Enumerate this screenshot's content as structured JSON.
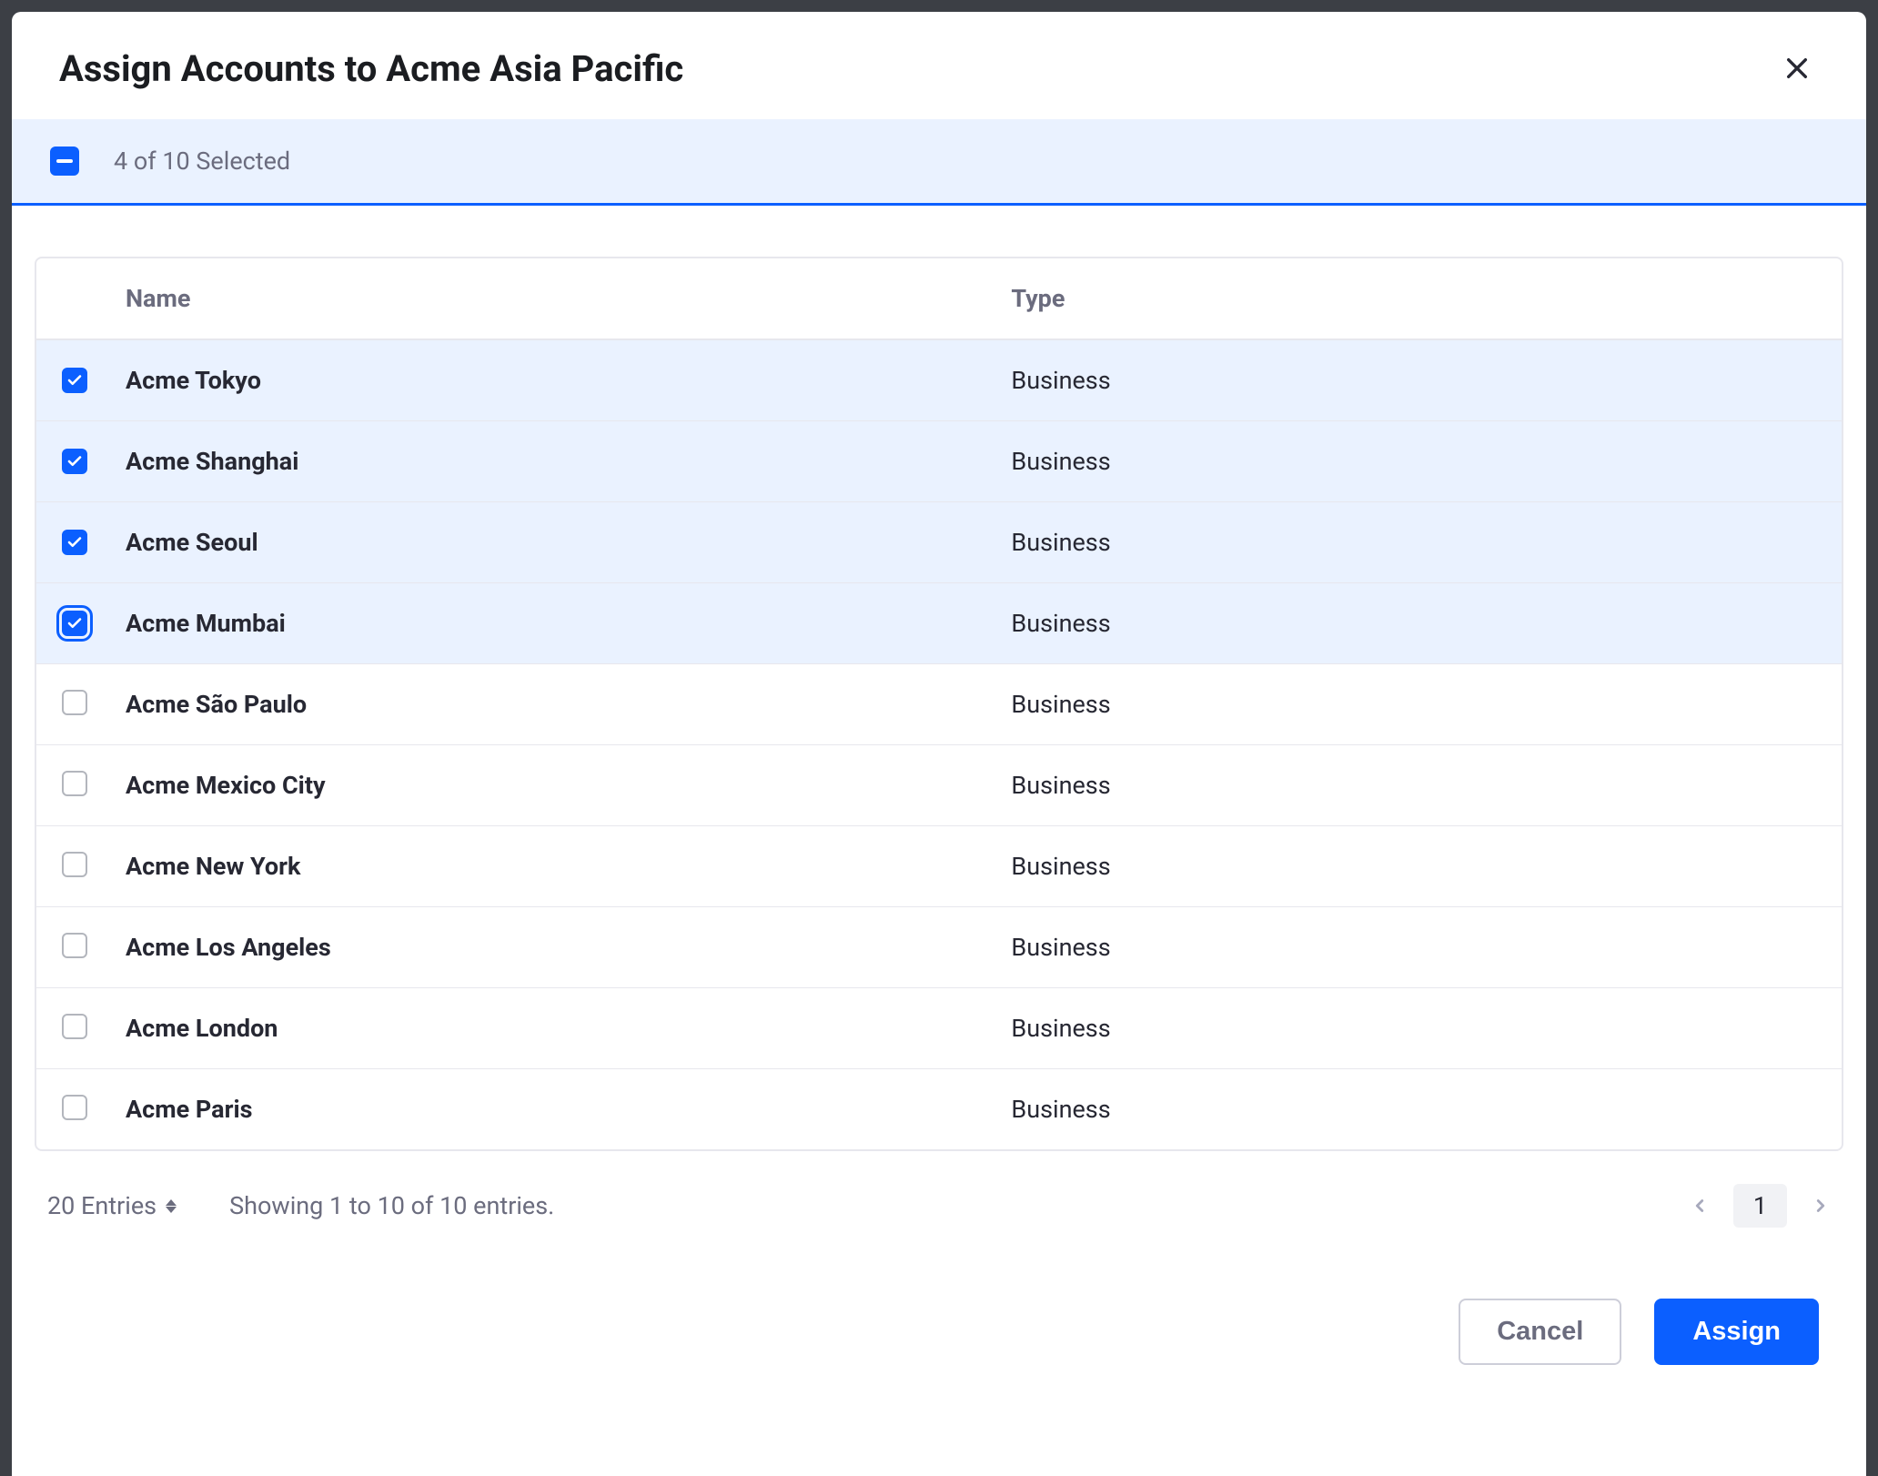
{
  "modal": {
    "title": "Assign Accounts to Acme Asia Pacific",
    "selection_text": "4 of 10 Selected"
  },
  "columns": {
    "name": "Name",
    "type": "Type"
  },
  "rows": [
    {
      "name": "Acme Tokyo",
      "type": "Business",
      "checked": true,
      "focused": false
    },
    {
      "name": "Acme Shanghai",
      "type": "Business",
      "checked": true,
      "focused": false
    },
    {
      "name": "Acme Seoul",
      "type": "Business",
      "checked": true,
      "focused": false
    },
    {
      "name": "Acme Mumbai",
      "type": "Business",
      "checked": true,
      "focused": true
    },
    {
      "name": "Acme São Paulo",
      "type": "Business",
      "checked": false,
      "focused": false
    },
    {
      "name": "Acme Mexico City",
      "type": "Business",
      "checked": false,
      "focused": false
    },
    {
      "name": "Acme New York",
      "type": "Business",
      "checked": false,
      "focused": false
    },
    {
      "name": "Acme Los Angeles",
      "type": "Business",
      "checked": false,
      "focused": false
    },
    {
      "name": "Acme London",
      "type": "Business",
      "checked": false,
      "focused": false
    },
    {
      "name": "Acme Paris",
      "type": "Business",
      "checked": false,
      "focused": false
    }
  ],
  "footer": {
    "entries_label": "20 Entries",
    "showing_text": "Showing 1 to 10 of 10 entries.",
    "current_page": "1",
    "cancel_label": "Cancel",
    "assign_label": "Assign"
  }
}
